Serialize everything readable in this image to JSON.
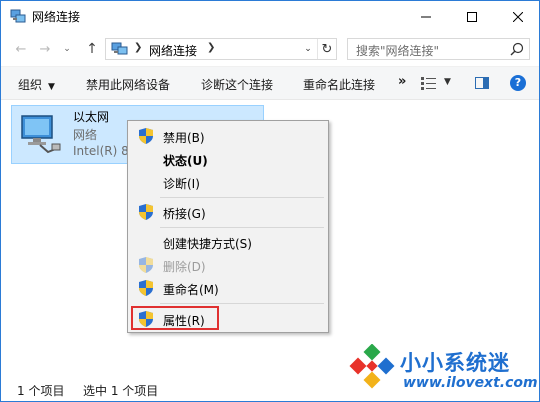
{
  "window": {
    "title": "网络连接",
    "minimize_icon": "minimize-icon",
    "maximize_icon": "maximize-icon",
    "close_icon": "close-icon"
  },
  "nav": {
    "back_icon": "back-arrow-icon",
    "forward_icon": "forward-arrow-icon",
    "up_icon": "up-arrow-icon",
    "breadcrumb": "网络连接",
    "search_placeholder": "搜索\"网络连接\""
  },
  "toolbar": {
    "organize": "组织",
    "disable_device": "禁用此网络设备",
    "diagnose": "诊断这个连接",
    "rename": "重命名此连接",
    "more": "»"
  },
  "connection": {
    "name": "以太网",
    "status": "网络",
    "adapter": "Intel(R) 82"
  },
  "context_menu": {
    "items": [
      {
        "label": "禁用(B)",
        "shield": true,
        "bold": false,
        "disabled": false
      },
      {
        "label": "状态(U)",
        "shield": false,
        "bold": true,
        "disabled": false
      },
      {
        "label": "诊断(I)",
        "shield": false,
        "bold": false,
        "disabled": false
      },
      {
        "label": "桥接(G)",
        "shield": true,
        "bold": false,
        "disabled": false
      },
      {
        "label": "创建快捷方式(S)",
        "shield": false,
        "bold": false,
        "disabled": false
      },
      {
        "label": "删除(D)",
        "shield": true,
        "bold": false,
        "disabled": true
      },
      {
        "label": "重命名(M)",
        "shield": true,
        "bold": false,
        "disabled": false
      },
      {
        "label": "属性(R)",
        "shield": true,
        "bold": false,
        "disabled": false,
        "highlighted": true
      }
    ]
  },
  "statusbar": {
    "count": "1 个项目",
    "selected": "选中 1 个项目"
  },
  "watermark": {
    "title": "小小系统迷",
    "url": "www.ilovext.com"
  },
  "colors": {
    "accent": "#1a6fd6",
    "selection_bg": "#cce8ff",
    "highlight_border": "#e03030",
    "watermark": "#1f6fcf"
  }
}
